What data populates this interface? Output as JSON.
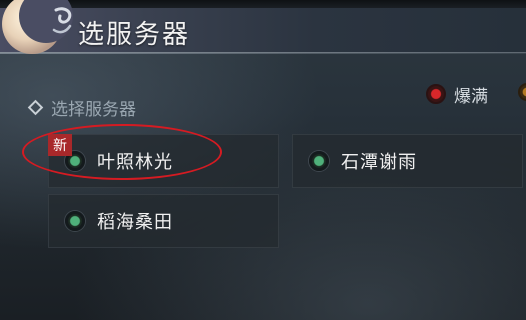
{
  "header": {
    "title": "选服务器"
  },
  "section": {
    "label": "选择服务器"
  },
  "legend": {
    "full_label": "爆满"
  },
  "servers": [
    {
      "name": "叶照林光",
      "badge": "新",
      "status": "green"
    },
    {
      "name": "石潭谢雨",
      "status": "green"
    },
    {
      "name": "稻海桑田",
      "status": "green"
    }
  ],
  "colors": {
    "status_green": "#4fb07a",
    "status_full_red": "#d8272a",
    "new_badge_red": "#a8282a",
    "highlight_ellipse": "#d51b22"
  },
  "icons": [
    "crescent-moon-logo-icon",
    "diamond-bullet-icon",
    "red-status-dot-icon",
    "green-status-dot-icon"
  ]
}
